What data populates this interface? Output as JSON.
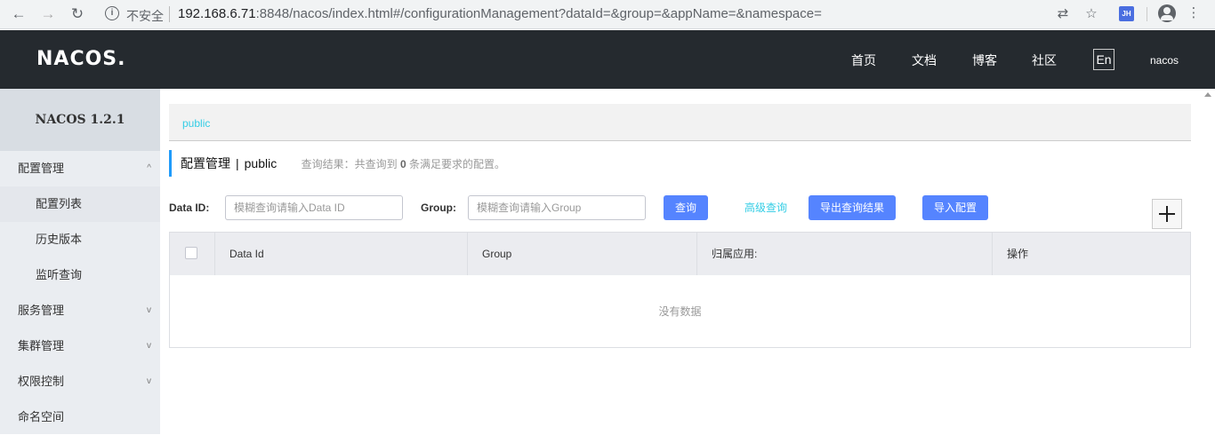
{
  "browser": {
    "insecure_label": "不安全",
    "url_host": "192.168.6.71",
    "url_rest": ":8848/nacos/index.html#/configurationManagement?dataId=&group=&appName=&namespace=",
    "ext_label": "JH"
  },
  "header": {
    "logo": "NACOS.",
    "nav": [
      "首页",
      "文档",
      "博客",
      "社区"
    ],
    "lang": "En",
    "user": "nacos"
  },
  "sidebar": {
    "title": "NACOS 1.2.1",
    "items": [
      {
        "label": "配置管理",
        "chevron": "^"
      },
      {
        "label": "配置列表"
      },
      {
        "label": "历史版本"
      },
      {
        "label": "监听查询"
      },
      {
        "label": "服务管理",
        "chevron": "v"
      },
      {
        "label": "集群管理",
        "chevron": "v"
      },
      {
        "label": "权限控制",
        "chevron": "v"
      },
      {
        "label": "命名空间"
      }
    ]
  },
  "main": {
    "namespace_link": "public",
    "title": "配置管理",
    "title_sep": "|",
    "title_ns": "public",
    "hint_prefix": "查询结果：共查询到",
    "hint_count": "0",
    "hint_suffix": "条满足要求的配置。",
    "filter": {
      "dataid_label": "Data ID:",
      "dataid_placeholder": "模糊查询请输入Data ID",
      "group_label": "Group:",
      "group_placeholder": "模糊查询请输入Group",
      "query_button": "查询",
      "advanced_link": "高级查询",
      "export_button": "导出查询结果",
      "import_button": "导入配置"
    },
    "table": {
      "columns": [
        "Data Id",
        "Group",
        "归属应用:",
        "操作"
      ],
      "empty": "没有数据"
    }
  }
}
